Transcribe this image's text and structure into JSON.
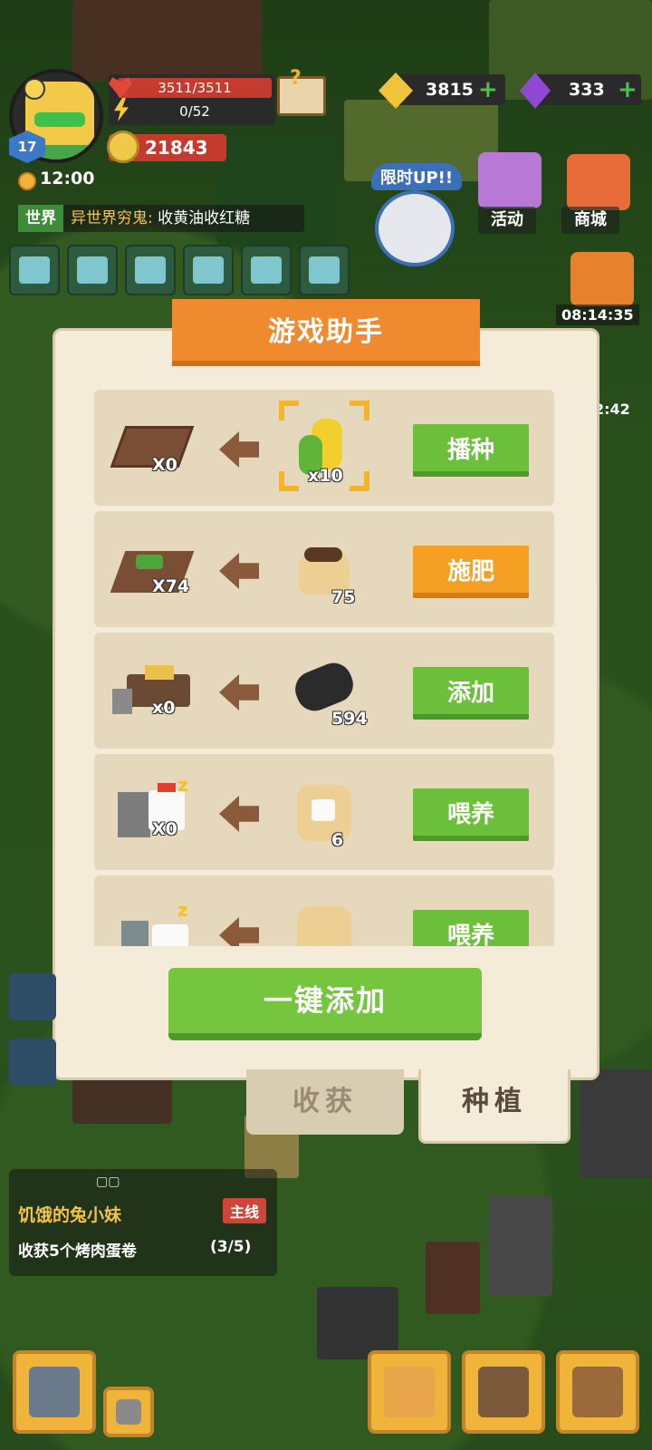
{
  "hud": {
    "level": "17",
    "hp": "3511/3511",
    "energy": "0/52",
    "coins": "21843",
    "time": "12:00",
    "gold_gems": "3815",
    "purple_gems": "333",
    "limited_up": "限时UP!!",
    "event_label": "活动",
    "store_label": "商城",
    "timer_1": "08:14:35",
    "timer_2": "2:42"
  },
  "chat": {
    "channel": "世界",
    "name": "异世界穷鬼:",
    "message": "收黄油收红糖"
  },
  "dialog": {
    "title": "游戏助手",
    "rows": [
      {
        "src_count": "X0",
        "item_count": "x10",
        "action": "播种",
        "action_color": "green"
      },
      {
        "src_count": "X74",
        "item_count": "75",
        "action": "施肥",
        "action_color": "orange"
      },
      {
        "src_count": "x0",
        "item_count": "594",
        "action": "添加",
        "action_color": "green"
      },
      {
        "src_count": "X0",
        "item_count": "6",
        "action": "喂养",
        "action_color": "green"
      },
      {
        "src_count": "",
        "item_count": "",
        "action": "喂养",
        "action_color": "green"
      }
    ],
    "one_key_label": "一键添加",
    "tabs": {
      "harvest": "收获",
      "plant": "种植"
    }
  },
  "quest": {
    "dots": "▢▢",
    "title": "饥饿的兔小妹",
    "tag": "主线",
    "desc": "收获5个烤肉蛋卷",
    "progress": "(3/5)"
  },
  "colors": {
    "accent_orange": "#f08a2e",
    "action_green": "#6bbf3a",
    "action_orange": "#f6a023",
    "panel_bg": "#f4ecd9"
  }
}
